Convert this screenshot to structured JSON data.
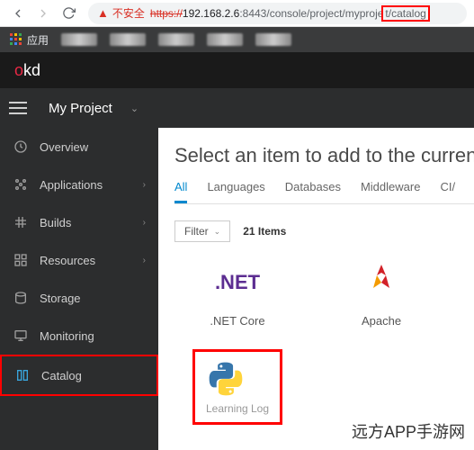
{
  "browser": {
    "warn_text": "不安全",
    "url_https": "https://",
    "url_host": "192.168.2.6",
    "url_port_path": ":8443/console/project/myproje",
    "url_highlight": "t/catalog"
  },
  "bookmarks": {
    "apps": "应用"
  },
  "header": {
    "logo_o": "o",
    "logo_rest": "kd"
  },
  "project": {
    "name": "My Project"
  },
  "sidebar": {
    "items": [
      {
        "label": "Overview",
        "expandable": false
      },
      {
        "label": "Applications",
        "expandable": true
      },
      {
        "label": "Builds",
        "expandable": true
      },
      {
        "label": "Resources",
        "expandable": true
      },
      {
        "label": "Storage",
        "expandable": false
      },
      {
        "label": "Monitoring",
        "expandable": false
      },
      {
        "label": "Catalog",
        "expandable": false,
        "active": true
      }
    ]
  },
  "content": {
    "heading": "Select an item to add to the curren",
    "tabs": [
      {
        "label": "All",
        "active": true
      },
      {
        "label": "Languages"
      },
      {
        "label": "Databases"
      },
      {
        "label": "Middleware"
      },
      {
        "label": "CI/"
      }
    ],
    "filter_label": "Filter",
    "item_count": "21 Items",
    "cards": {
      "net_logo": ".NET",
      "net_label": ".NET Core",
      "apache_label": "Apache",
      "learning_log": "Learning Log"
    }
  },
  "watermark": "远方APP手游网"
}
